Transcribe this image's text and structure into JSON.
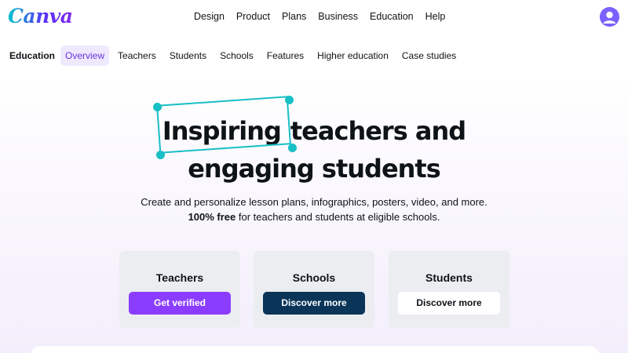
{
  "brand": {
    "logo_text": "Canva"
  },
  "top_menu": [
    "Design",
    "Product",
    "Plans",
    "Business",
    "Education",
    "Help"
  ],
  "sub_nav": {
    "section": "Education",
    "items": [
      "Overview",
      "Teachers",
      "Students",
      "Schools",
      "Features",
      "Higher education",
      "Case studies"
    ],
    "active": "Overview"
  },
  "hero": {
    "headline_highlight": "Inspiring",
    "headline_rest_line1": "teachers and",
    "headline_line2": "engaging students",
    "subtitle_line1": "Create and personalize lesson plans, infographics, posters, video, and more.",
    "subtitle_bold": "100% free",
    "subtitle_line2_rest": " for teachers and students at eligible schools."
  },
  "cards": [
    {
      "title": "Teachers",
      "button": "Get verified",
      "button_style": "purple"
    },
    {
      "title": "Schools",
      "button": "Discover more",
      "button_style": "navy"
    },
    {
      "title": "Students",
      "button": "Discover more",
      "button_style": "white"
    }
  ],
  "colors": {
    "accent_purple": "#8b3dff",
    "navy": "#0a3558",
    "teal_selection": "#18bfc5",
    "active_tab_bg": "#efe9fd"
  },
  "icons": {
    "avatar": "user-avatar-icon"
  }
}
